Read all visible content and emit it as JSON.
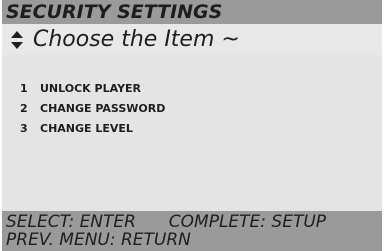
{
  "header": {
    "title": "SECURITY SETTINGS",
    "prompt": "Choose the Item ~",
    "prompt_icon": "up-down-arrows-icon"
  },
  "menu": {
    "items": [
      {
        "number": "1",
        "label": "UNLOCK PLAYER"
      },
      {
        "number": "2",
        "label": "CHANGE PASSWORD"
      },
      {
        "number": "3",
        "label": "CHANGE LEVEL"
      }
    ]
  },
  "footer": {
    "select_hint": "SELECT: ENTER",
    "complete_hint": "COMPLETE: SETUP",
    "prev_hint": "PREV. MENU: RETURN"
  },
  "colors": {
    "bar_gray": "#9a9a9a",
    "panel_light": "#e4e4e4",
    "text_dark": "#1e1e1e"
  }
}
